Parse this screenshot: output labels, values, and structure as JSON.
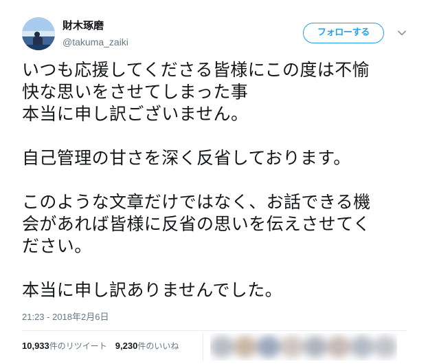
{
  "user": {
    "display_name": "財木琢磨",
    "screen_name": "@takuma_zaiki",
    "avatar_icon": "user-avatar-icon"
  },
  "header": {
    "follow_label": "フォローする",
    "menu_icon": "chevron-down-icon"
  },
  "tweet": {
    "lines": [
      "いつも応援してくださる皆様にこの度は不愉",
      "快な思いをさせてしまった事",
      "本当に申し訳ございません。",
      "自己管理の甘さを深く反省しております。",
      "このような文章だけではなく、お話できる機",
      "会があれば皆様に反省の思いを伝えさせてく",
      "ださい。",
      "本当に申し訳ありませんでした。"
    ],
    "timestamp": "21:23 - 2018年2月6日"
  },
  "stats": {
    "retweets_count": "10,933",
    "retweets_label": "件のリツイート",
    "likes_count": "9,230",
    "likes_label": "件のいいね"
  },
  "colors": {
    "accent": "#1da1f2",
    "text_primary": "#14171a",
    "text_secondary": "#657786",
    "divider": "#e6ecf0"
  }
}
